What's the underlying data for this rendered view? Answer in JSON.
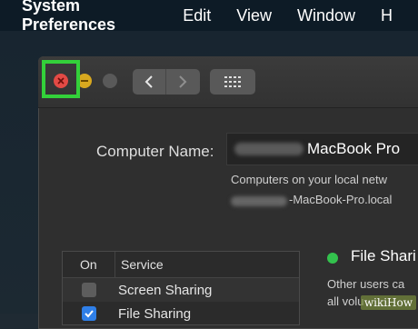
{
  "menubar": {
    "app_name": "System Preferences",
    "items": [
      "Edit",
      "View",
      "Window",
      "H"
    ]
  },
  "window": {
    "buttons": {
      "close": "close-icon",
      "minimize": "minimize-icon",
      "zoom": "zoom-icon"
    },
    "nav": {
      "back": "chevron-left-icon",
      "forward": "chevron-right-icon",
      "show_all": "grid-icon"
    }
  },
  "sharing": {
    "computer_name_label": "Computer Name:",
    "computer_name_value": "MacBook Pro",
    "info_line1": "Computers on your local netw",
    "info_line2": "-MacBook-Pro.local",
    "table": {
      "headers": [
        "On",
        "Service"
      ],
      "rows": [
        {
          "on": false,
          "service": "Screen Sharing"
        },
        {
          "on": true,
          "service": "File Sharing"
        }
      ]
    },
    "status": {
      "title": "File Shari",
      "desc_line1": "Other users ca",
      "desc_line2": "all volu"
    }
  },
  "watermark": "wikiHow",
  "colors": {
    "highlight": "#33d13a",
    "close": "#e34a45",
    "minimize": "#d8a81f",
    "status_on": "#33c24d",
    "checkbox_on": "#2f7fe8"
  }
}
